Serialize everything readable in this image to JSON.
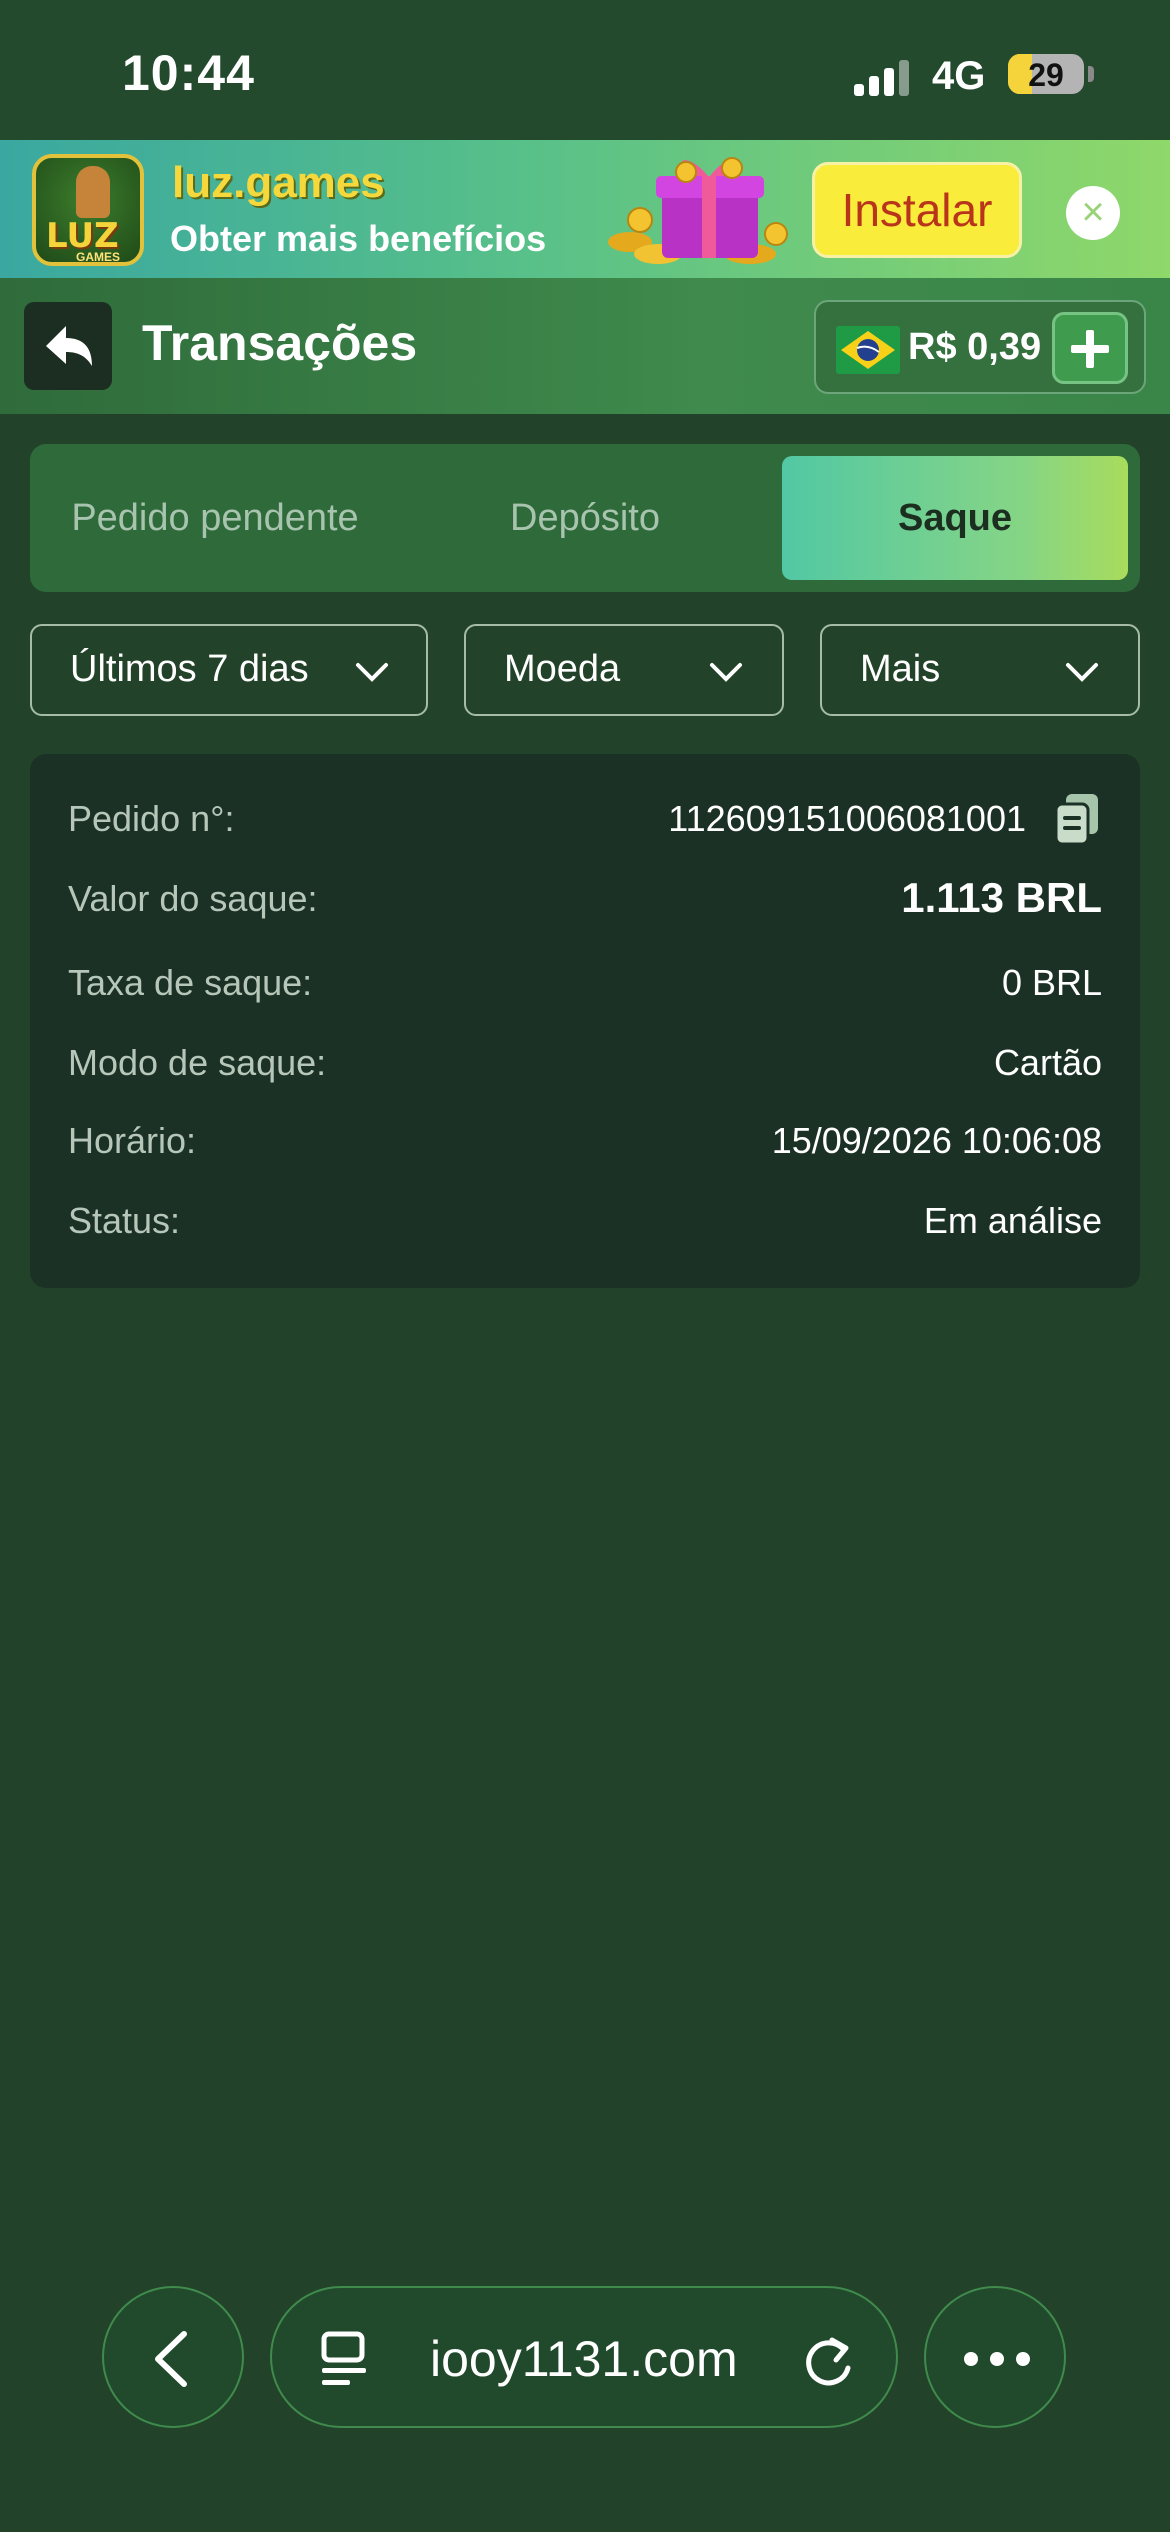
{
  "status_bar": {
    "time": "10:44",
    "network": "4G",
    "battery": "29"
  },
  "banner": {
    "app_name": "luz.games",
    "subtitle": "Obter mais benefícios",
    "icon_text": "LUZ",
    "icon_subtext": "GAMES",
    "install_label": "Instalar",
    "close_icon": "close-icon"
  },
  "header": {
    "title": "Transações",
    "balance": "R$ 0,39",
    "flag_icon": "brazil-flag-icon"
  },
  "tabs": [
    {
      "label": "Pedido pendente",
      "active": false
    },
    {
      "label": "Depósito",
      "active": false
    },
    {
      "label": "Saque",
      "active": true
    }
  ],
  "filters": [
    {
      "label": "Últimos 7 dias"
    },
    {
      "label": "Moeda"
    },
    {
      "label": "Mais"
    }
  ],
  "transaction": {
    "order_label": "Pedido n°:",
    "order_value": "112609151006081001",
    "amount_label": "Valor do saque:",
    "amount_value": "1.113 BRL",
    "fee_label": "Taxa de saque:",
    "fee_value": "0 BRL",
    "mode_label": "Modo de saque:",
    "mode_value": "Cartão",
    "time_label": "Horário:",
    "time_value": "15/09/2026 10:06:08",
    "status_label": "Status:",
    "status_value": "Em análise"
  },
  "browser": {
    "url": "iooy1131.com"
  },
  "colors": {
    "background": "#224329",
    "card": "#1c3125",
    "accent_start": "#52c8a4",
    "accent_end": "#a8dc5c",
    "install_button": "#f9ec3a"
  }
}
